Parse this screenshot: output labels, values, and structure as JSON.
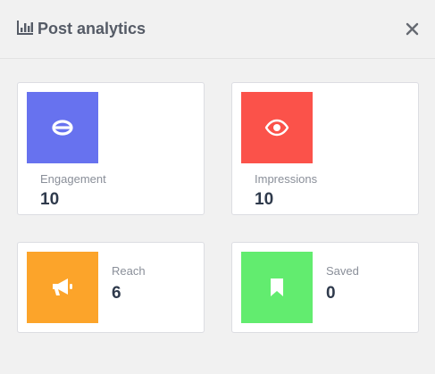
{
  "header": {
    "title": "Post analytics",
    "icon": "bar-chart-icon",
    "close_icon": "close-icon"
  },
  "stats": [
    {
      "label": "Engagement",
      "value": "10",
      "icon": "ring-icon",
      "color": "#6772ef"
    },
    {
      "label": "Impressions",
      "value": "10",
      "icon": "eye-icon",
      "color": "#fb524a"
    },
    {
      "label": "Reach",
      "value": "6",
      "icon": "megaphone-icon",
      "color": "#fca42a"
    },
    {
      "label": "Saved",
      "value": "0",
      "icon": "bookmark-icon",
      "color": "#62ec6f"
    }
  ]
}
